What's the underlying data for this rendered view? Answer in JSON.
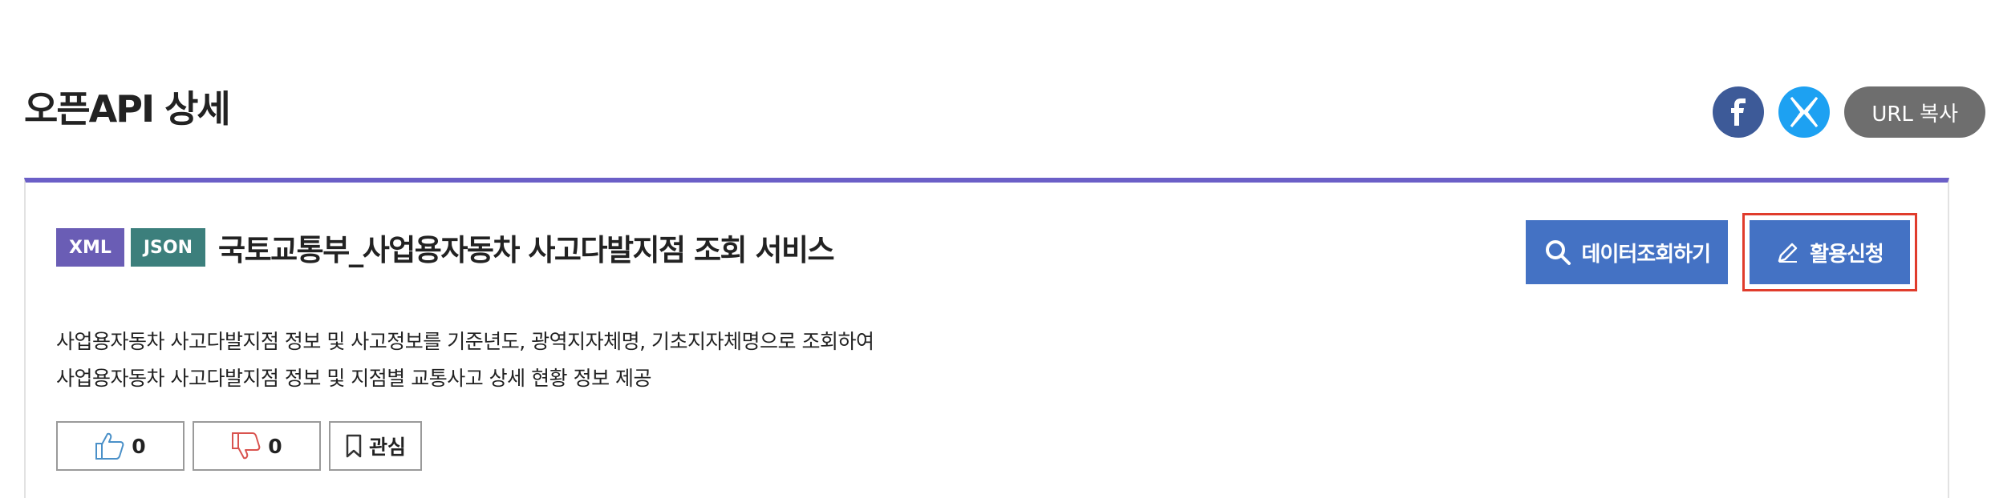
{
  "page_title": "오픈API 상세",
  "share": {
    "facebook_icon": "facebook-icon",
    "x_icon": "x-twitter-icon",
    "url_copy_label": "URL 복사"
  },
  "api": {
    "badges": [
      "XML",
      "JSON"
    ],
    "title": "국토교통부_사업용자동차 사고다발지점 조회 서비스",
    "description_lines": [
      "사업용자동차 사고다발지점 정보 및 사고정보를 기준년도, 광역지자체명, 기초지자체명으로 조회하여",
      "사업용자동차 사고다발지점 정보 및 지점별 교통사고 상세 현황 정보 제공"
    ]
  },
  "actions": {
    "data_view_label": "데이터조회하기",
    "apply_label": "활용신청"
  },
  "reactions": {
    "like_count": "0",
    "dislike_count": "0",
    "bookmark_label": "관심"
  },
  "colors": {
    "accent_border": "#6b5fc7",
    "button_blue": "#4472c4",
    "xml_badge": "#6a5db5",
    "json_badge": "#3c7f7c",
    "highlight_red": "#e03c2c"
  }
}
